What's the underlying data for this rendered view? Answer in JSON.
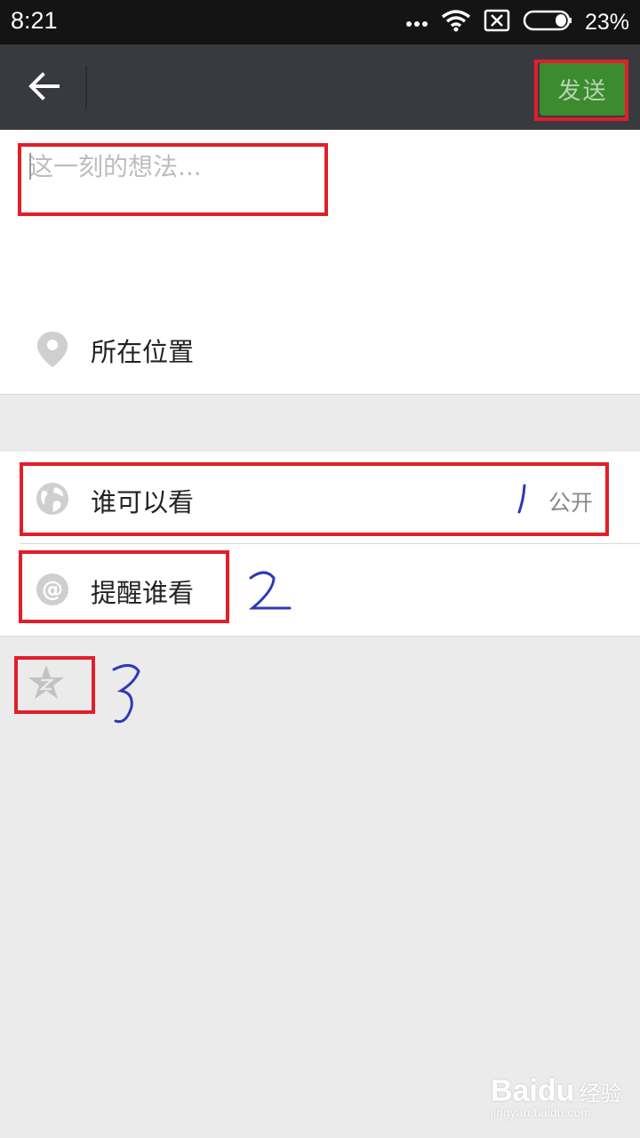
{
  "status_bar": {
    "time": "8:21",
    "battery_percent": "23%",
    "icons": [
      "more-dots-icon",
      "wifi-icon",
      "sim-disabled-icon",
      "battery-icon"
    ]
  },
  "toolbar": {
    "back_icon": "arrow-left-icon",
    "send_label": "发送",
    "send_color": "#3c8b2f"
  },
  "composer": {
    "placeholder": "这一刻的想法...",
    "value": ""
  },
  "location": {
    "label": "所在位置",
    "icon": "location-pin-icon"
  },
  "visibility": {
    "label": "谁可以看",
    "value": "公开",
    "icon": "globe-icon"
  },
  "mention": {
    "label": "提醒谁看",
    "icon": "at-sign-icon"
  },
  "qzone": {
    "icon": "qzone-star-icon"
  },
  "annotations": {
    "num_1": "1",
    "num_2": "2",
    "num_3": "3"
  },
  "watermark": {
    "brand": "Baidu",
    "brand_cn": "经验",
    "url": "jingyan.baidu.com"
  }
}
